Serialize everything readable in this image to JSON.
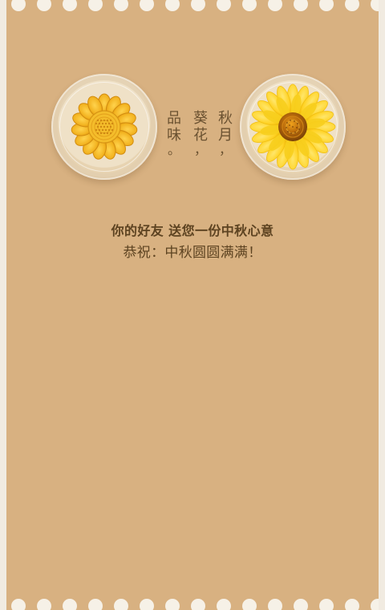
{
  "poem": {
    "columns": [
      {
        "chars": [
          "品",
          "味",
          "。"
        ]
      },
      {
        "chars": [
          "葵",
          "花",
          "，"
        ]
      },
      {
        "chars": [
          "秋",
          "月",
          "，"
        ]
      }
    ]
  },
  "message": {
    "line1": "你的好友 送您一份中秋心意",
    "line2": "恭祝：中秋圆圆满满！"
  }
}
